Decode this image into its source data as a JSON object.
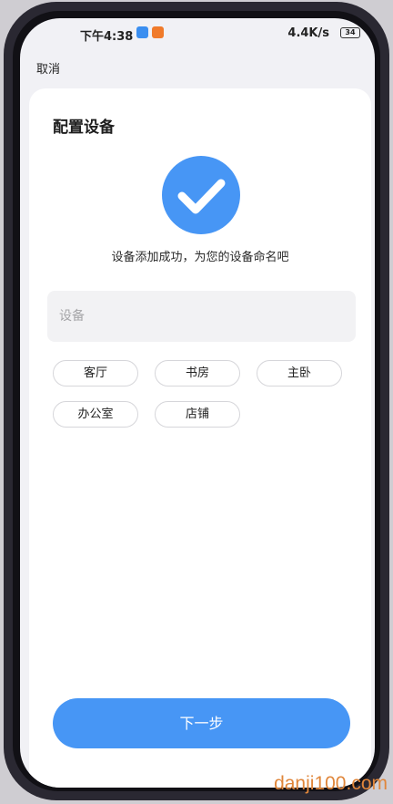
{
  "status_bar": {
    "time": "下午4:38",
    "network_speed": "4.4K/s",
    "battery": "34"
  },
  "nav": {
    "cancel_label": "取消"
  },
  "page": {
    "title": "配置设备",
    "success_message": "设备添加成功，为您的设备命名吧"
  },
  "name_input": {
    "placeholder": "设备",
    "value": ""
  },
  "name_suggestions": [
    "客厅",
    "书房",
    "主卧",
    "办公室",
    "店铺"
  ],
  "actions": {
    "next_label": "下一步"
  },
  "watermark": "danji100.com",
  "colors": {
    "accent": "#4796f5",
    "card": "#ffffff",
    "screen_background": "#f1f1f5"
  }
}
